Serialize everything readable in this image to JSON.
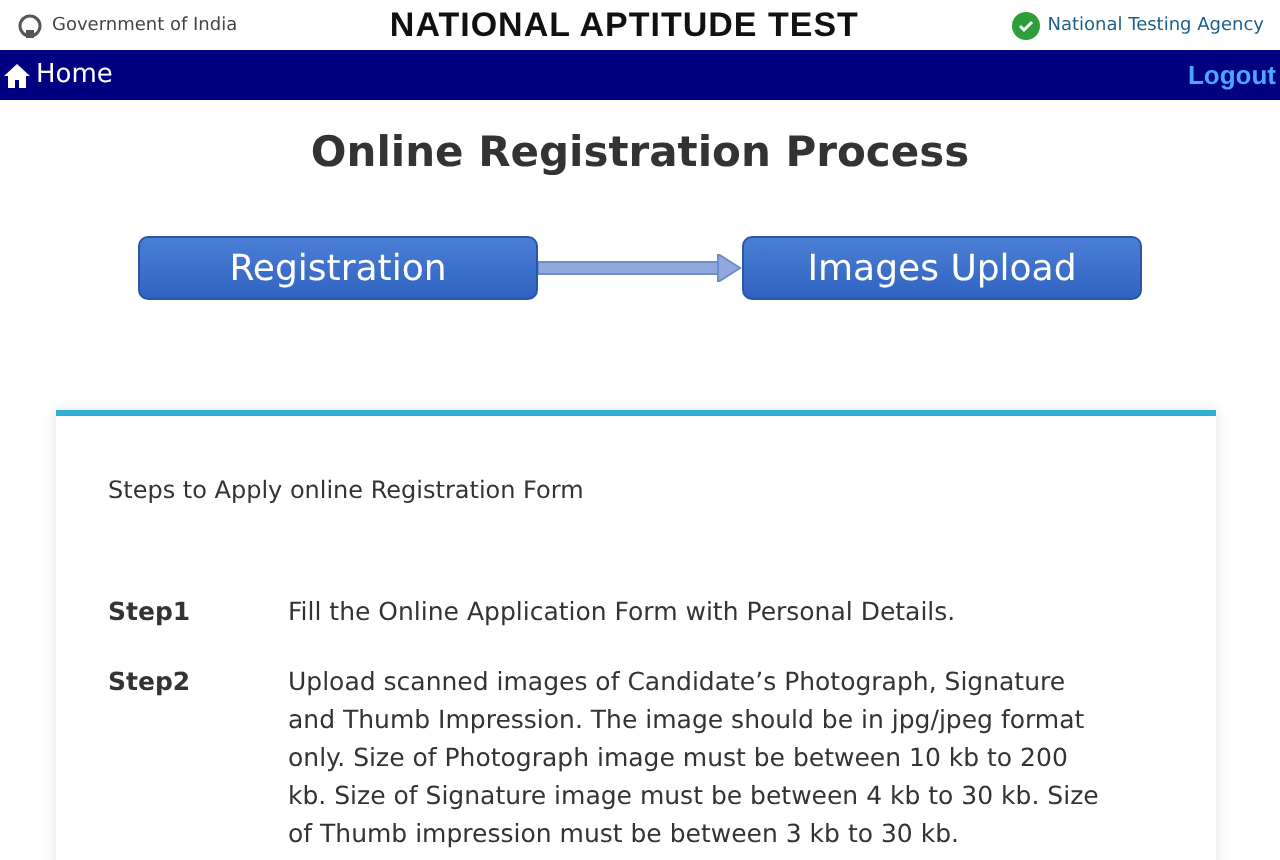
{
  "header": {
    "left_text": "Government of India",
    "title": "NATIONAL APTITUDE TEST",
    "right_text": "National Testing Agency"
  },
  "nav": {
    "home": "Home",
    "logout": "Logout"
  },
  "page_title": "Online Registration Process",
  "flow": [
    {
      "label": "Registration"
    },
    {
      "label": "Images Upload"
    }
  ],
  "card": {
    "intro": "Steps to Apply online Registration Form",
    "steps": [
      {
        "label": "Step1",
        "text": "Fill the Online Application Form with Personal Details."
      },
      {
        "label": "Step2",
        "text": "Upload scanned images of Candidate’s Photograph, Signature and Thumb Impression. The image should be in jpg/jpeg format only. Size of Photograph image must be between 10 kb to 200 kb. Size of Signature image must be between 4 kb to 30 kb. Size of Thumb impression must be between 3 kb to 30 kb."
      }
    ]
  }
}
